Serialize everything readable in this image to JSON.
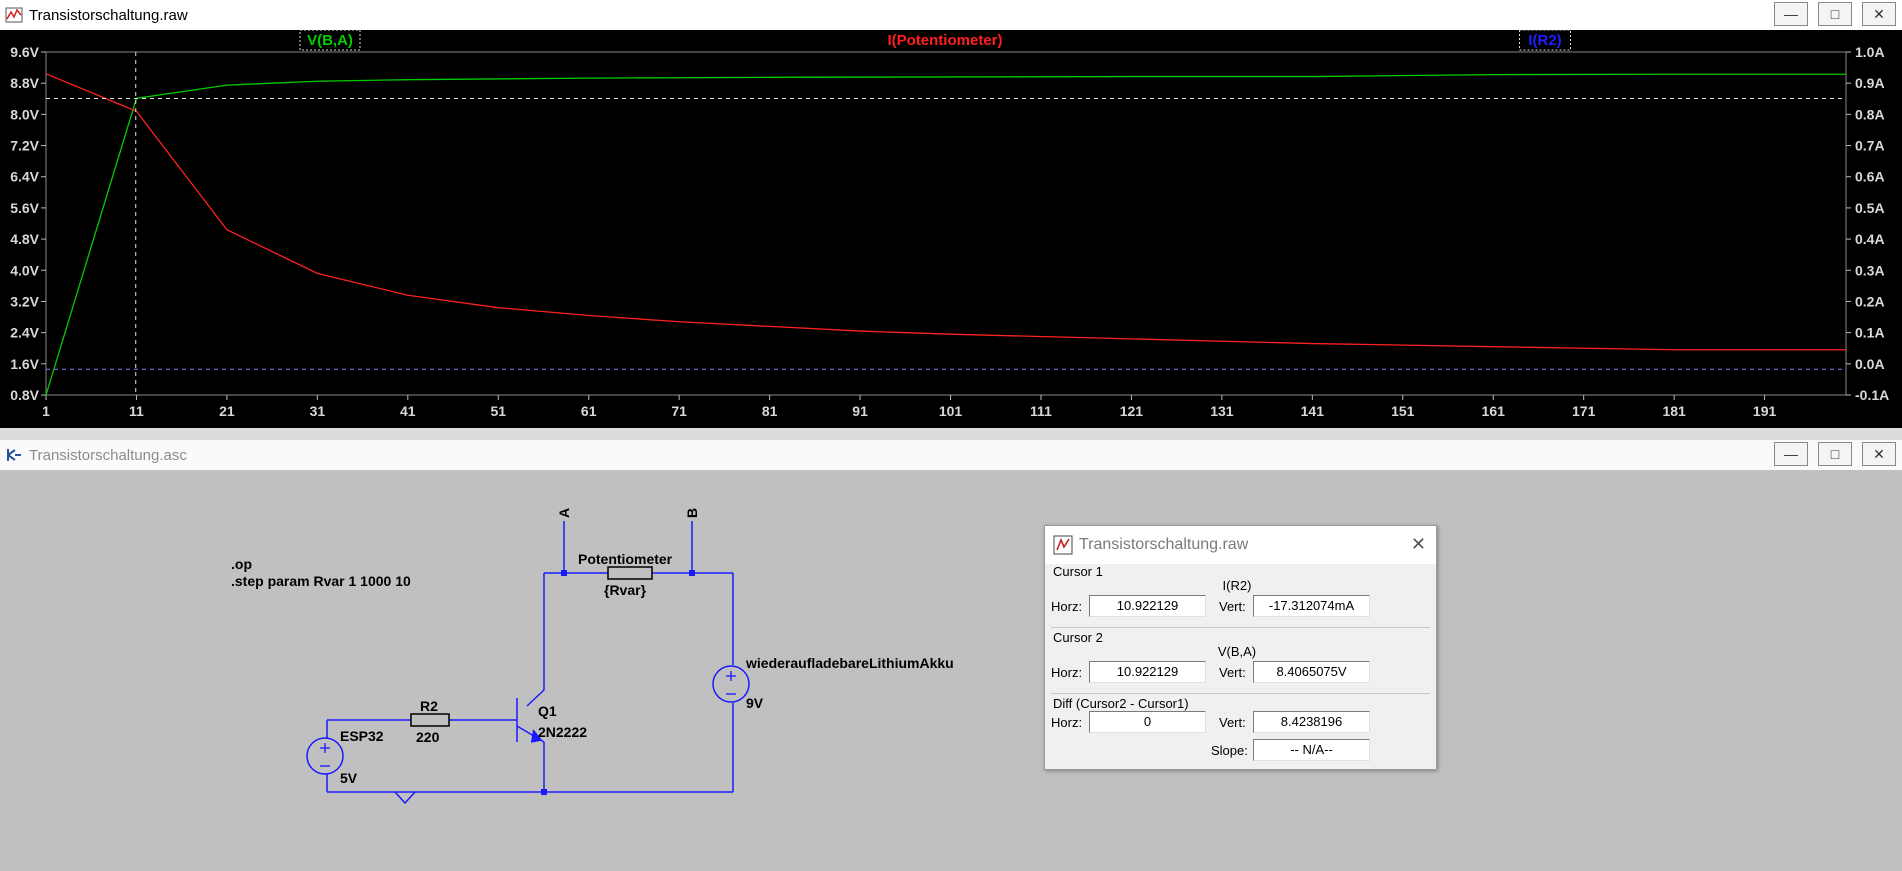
{
  "plot_window": {
    "title": "Transistorschaltung.raw",
    "traces": [
      {
        "label": "V(B,A)",
        "color": "#00cc00"
      },
      {
        "label": "I(Potentiometer)",
        "color": "#ff2020"
      },
      {
        "label": "I(R2)",
        "color": "#2020ff"
      }
    ],
    "left_axis_ticks": [
      "9.6V",
      "8.8V",
      "8.0V",
      "7.2V",
      "6.4V",
      "5.6V",
      "4.8V",
      "4.0V",
      "3.2V",
      "2.4V",
      "1.6V",
      "0.8V"
    ],
    "right_axis_ticks": [
      "1.0A",
      "0.9A",
      "0.8A",
      "0.7A",
      "0.6A",
      "0.5A",
      "0.4A",
      "0.3A",
      "0.2A",
      "0.1A",
      "0.0A",
      "-0.1A"
    ],
    "x_axis_ticks": [
      "1",
      "11",
      "21",
      "31",
      "41",
      "51",
      "61",
      "71",
      "81",
      "91",
      "101",
      "111",
      "121",
      "131",
      "141",
      "151",
      "161",
      "171",
      "181",
      "191"
    ]
  },
  "chart_data": {
    "type": "line",
    "x_ticks": [
      1,
      11,
      21,
      31,
      41,
      51,
      61,
      71,
      81,
      91,
      101,
      111,
      121,
      131,
      141,
      151,
      161,
      171,
      181,
      191
    ],
    "xlim": [
      1,
      200
    ],
    "left_ylim": [
      0.8,
      9.6
    ],
    "right_ylim": [
      -0.1,
      1.0
    ],
    "series": [
      {
        "name": "V(B,A)",
        "axis": "left",
        "color": "#00cc00",
        "x": [
          1,
          11,
          21,
          31,
          41,
          61,
          81,
          101,
          121,
          141,
          161,
          181,
          200
        ],
        "y": [
          0.8,
          8.41,
          8.75,
          8.85,
          8.89,
          8.93,
          8.95,
          8.96,
          8.97,
          8.97,
          9.02,
          9.03,
          9.03
        ]
      },
      {
        "name": "I(Potentiometer)",
        "axis": "right",
        "color": "#ff2020",
        "x": [
          1,
          11,
          21,
          31,
          41,
          51,
          61,
          71,
          81,
          91,
          101,
          121,
          141,
          161,
          181,
          200
        ],
        "y": [
          0.93,
          0.81,
          0.43,
          0.29,
          0.22,
          0.18,
          0.155,
          0.135,
          0.12,
          0.105,
          0.095,
          0.08,
          0.065,
          0.055,
          0.045,
          0.045
        ]
      }
    ],
    "cursors": {
      "x": 10.922129,
      "y_left": 8.4065075,
      "y_right": -0.017312074
    }
  },
  "schematic_window": {
    "title": "Transistorschaltung.asc",
    "directives": [
      ".op",
      ".step param Rvar 1 1000 10"
    ],
    "components": {
      "potentiometer_name": "Potentiometer",
      "potentiometer_value": "{Rvar}",
      "battery_name": "wiederaufladebareLithiumAkku",
      "battery_value": "9V",
      "r2_name": "R2",
      "r2_value": "220",
      "q1_name": "Q1",
      "q1_value": "2N2222",
      "esp_name": "ESP32",
      "esp_value": "5V",
      "label_a": "A",
      "label_b": "B"
    }
  },
  "cursor_dialog": {
    "title": "Transistorschaltung.raw",
    "cursor1": {
      "label": "Cursor 1",
      "trace": "I(R2)",
      "horz_label": "Horz:",
      "horz": "10.922129",
      "vert_label": "Vert:",
      "vert": "-17.312074mA"
    },
    "cursor2": {
      "label": "Cursor 2",
      "trace": "V(B,A)",
      "horz_label": "Horz:",
      "horz": "10.922129",
      "vert_label": "Vert:",
      "vert": "8.4065075V"
    },
    "diff": {
      "label": "Diff (Cursor2 - Cursor1)",
      "horz_label": "Horz:",
      "horz": "0",
      "vert_label": "Vert:",
      "vert": "8.4238196",
      "slope_label": "Slope:",
      "slope": "-- N/A--"
    }
  }
}
